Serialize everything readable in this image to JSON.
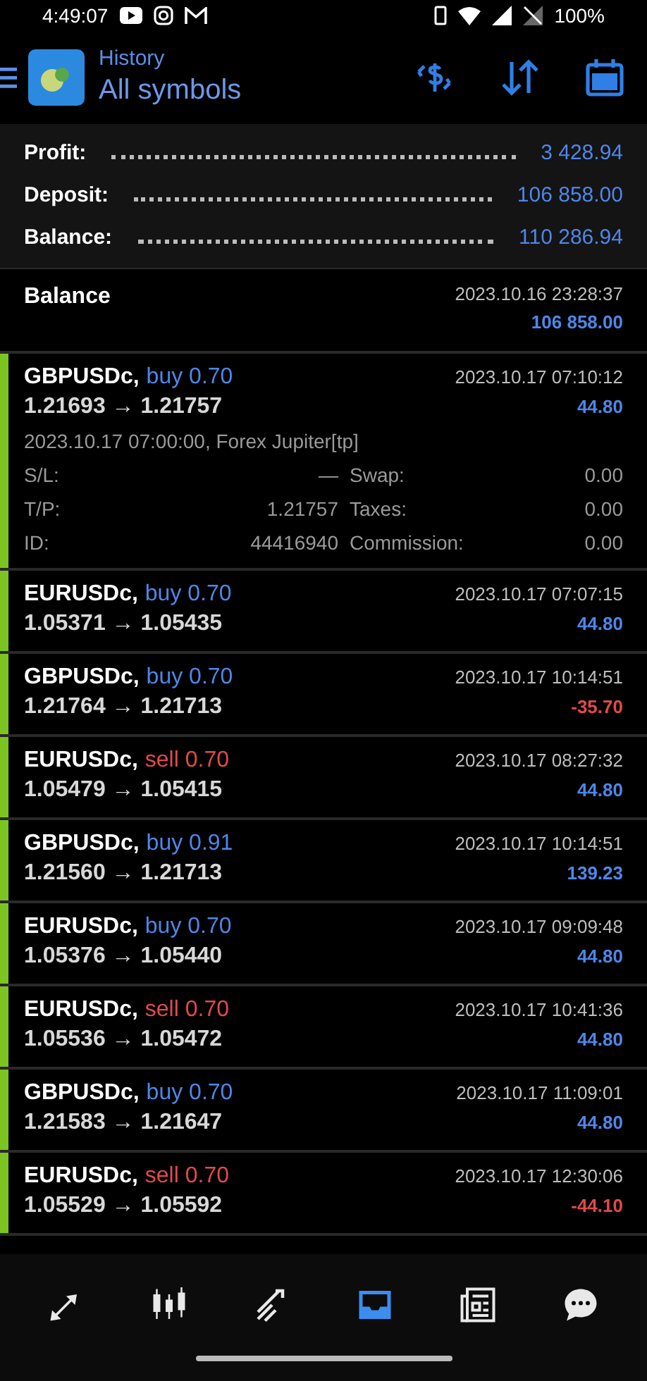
{
  "status_bar": {
    "time": "4:49:07",
    "battery": "100%"
  },
  "header": {
    "subtitle": "History",
    "title": "All symbols"
  },
  "summary": [
    {
      "label": "Profit:",
      "value": "3 428.94"
    },
    {
      "label": "Deposit:",
      "value": "106 858.00"
    },
    {
      "label": "Balance:",
      "value": "110 286.94"
    }
  ],
  "balance_entry": {
    "label": "Balance",
    "time": "2023.10.16 23:28:37",
    "amount": "106 858.00"
  },
  "trades": [
    {
      "symbol": "GBPUSDc,",
      "kind": "buy",
      "action": "buy 0.70",
      "prices": "1.21693 → 1.21757",
      "time": "2023.10.17 07:10:12",
      "profit": "44.80",
      "color": "#4f86e8",
      "details": {
        "info": "2023.10.17 07:00:00, Forex Jupiter[tp]",
        "fields": [
          {
            "label": "S/L:",
            "value": "—",
            "label2": "Swap:",
            "value2": "0.00"
          },
          {
            "label": "T/P:",
            "value": "1.21757",
            "label2": "Taxes:",
            "value2": "0.00"
          },
          {
            "label": "ID:",
            "value": "44416940",
            "label2": "Commission:",
            "value2": "0.00"
          }
        ]
      }
    },
    {
      "symbol": "EURUSDc,",
      "kind": "buy",
      "action": "buy 0.70",
      "prices": "1.05371 → 1.05435",
      "time": "2023.10.17 07:07:15",
      "profit": "44.80",
      "color": "#4f86e8"
    },
    {
      "symbol": "GBPUSDc,",
      "kind": "buy",
      "action": "buy 0.70",
      "prices": "1.21764 → 1.21713",
      "time": "2023.10.17 10:14:51",
      "profit": "-35.70",
      "color": "#e24a4a"
    },
    {
      "symbol": "EURUSDc,",
      "kind": "sell",
      "action": "sell 0.70",
      "prices": "1.05479 → 1.05415",
      "time": "2023.10.17 08:27:32",
      "profit": "44.80",
      "color": "#4f86e8"
    },
    {
      "symbol": "GBPUSDc,",
      "kind": "buy",
      "action": "buy 0.91",
      "prices": "1.21560 → 1.21713",
      "time": "2023.10.17 10:14:51",
      "profit": "139.23",
      "color": "#4f86e8"
    },
    {
      "symbol": "EURUSDc,",
      "kind": "buy",
      "action": "buy 0.70",
      "prices": "1.05376 → 1.05440",
      "time": "2023.10.17 09:09:48",
      "profit": "44.80",
      "color": "#4f86e8"
    },
    {
      "symbol": "EURUSDc,",
      "kind": "sell",
      "action": "sell 0.70",
      "prices": "1.05536 → 1.05472",
      "time": "2023.10.17 10:41:36",
      "profit": "44.80",
      "color": "#4f86e8"
    },
    {
      "symbol": "GBPUSDc,",
      "kind": "buy",
      "action": "buy 0.70",
      "prices": "1.21583 → 1.21647",
      "time": "2023.10.17 11:09:01",
      "profit": "44.80",
      "color": "#4f86e8"
    },
    {
      "symbol": "EURUSDc,",
      "kind": "sell",
      "action": "sell 0.70",
      "prices": "1.05529 → 1.05592",
      "time": "2023.10.17 12:30:06",
      "profit": "-44.10",
      "color": "#e24a4a"
    }
  ],
  "nav": [
    {
      "kind": "quotes",
      "selected": false
    },
    {
      "kind": "chart",
      "selected": false
    },
    {
      "kind": "trade",
      "selected": false
    },
    {
      "kind": "history",
      "selected": true
    },
    {
      "kind": "news",
      "selected": false
    },
    {
      "kind": "chat",
      "selected": false
    }
  ]
}
